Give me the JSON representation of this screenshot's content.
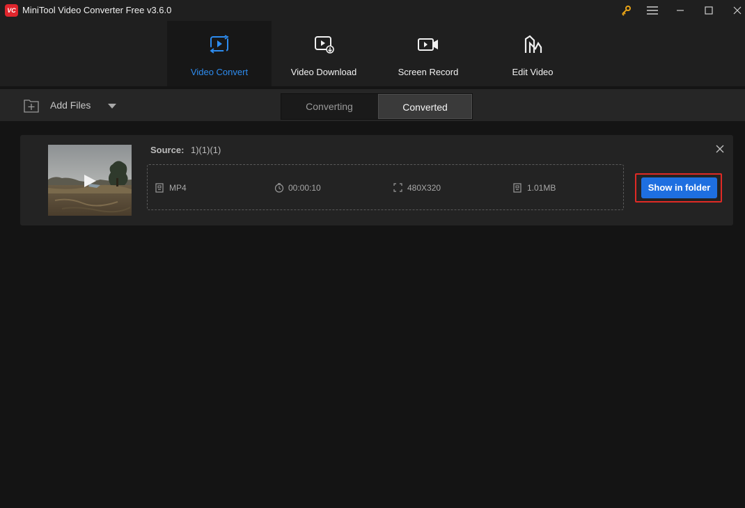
{
  "app": {
    "logo_text": "VC",
    "title": "MiniTool Video Converter Free v3.6.0"
  },
  "window_controls": [
    "key-icon",
    "menu-icon",
    "minimize-icon",
    "maximize-icon",
    "close-icon"
  ],
  "nav": {
    "tabs": [
      {
        "label": "Video Convert",
        "icon": "video-convert-icon",
        "active": true
      },
      {
        "label": "Video Download",
        "icon": "video-download-icon",
        "active": false
      },
      {
        "label": "Screen Record",
        "icon": "screen-record-icon",
        "active": false
      },
      {
        "label": "Edit Video",
        "icon": "edit-video-icon",
        "active": false
      }
    ]
  },
  "toolbar": {
    "add_files_label": "Add Files",
    "sub_tabs": [
      {
        "label": "Converting",
        "active": false
      },
      {
        "label": "Converted",
        "active": true
      }
    ]
  },
  "item": {
    "source_label": "Source:",
    "source_value": "1)(1)(1)",
    "format": "MP4",
    "duration": "00:00:10",
    "resolution": "480X320",
    "size": "1.01MB",
    "show_folder_label": "Show in folder"
  },
  "colors": {
    "accent": "#2d8cf0",
    "button": "#1e6fe0",
    "highlight": "#e02a25",
    "background": "#141414"
  }
}
